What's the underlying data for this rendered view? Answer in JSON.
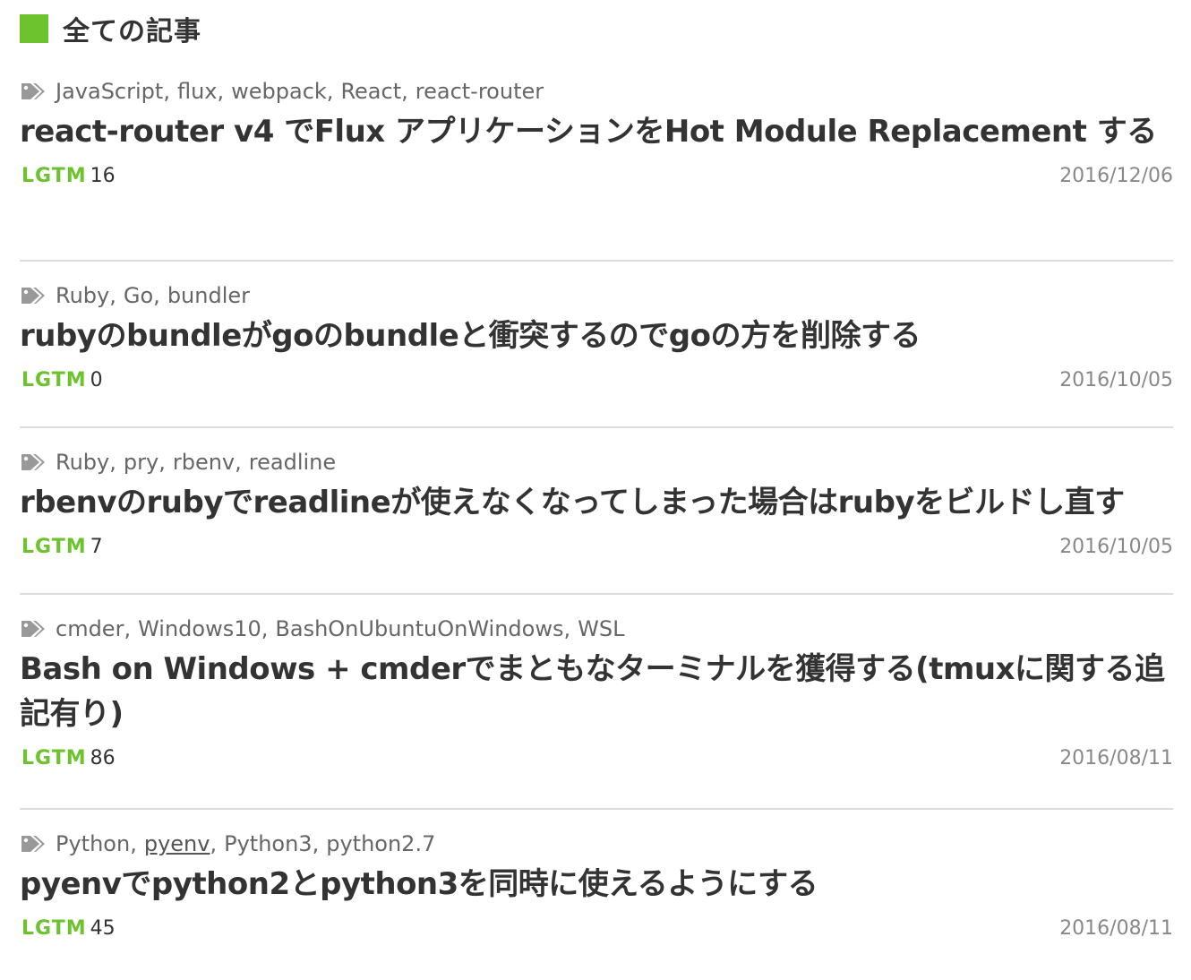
{
  "section": {
    "title": "全ての記事",
    "accent_color": "#6cc32d"
  },
  "lgtm_label": "LGTM",
  "articles": [
    {
      "tags": [
        "JavaScript",
        "flux",
        "webpack",
        "React",
        "react-router"
      ],
      "title": "react-router v4 でFlux アプリケーションをHot Module Replacement する",
      "lgtm": "16",
      "date": "2016/12/06"
    },
    {
      "tags": [
        "Ruby",
        "Go",
        "bundler"
      ],
      "title": "rubyのbundleがgoのbundleと衝突するのでgoの方を削除する",
      "lgtm": "0",
      "date": "2016/10/05"
    },
    {
      "tags": [
        "Ruby",
        "pry",
        "rbenv",
        "readline"
      ],
      "title": "rbenvのrubyでreadlineが使えなくなってしまった場合はrubyをビルドし直す",
      "lgtm": "7",
      "date": "2016/10/05"
    },
    {
      "tags": [
        "cmder",
        "Windows10",
        "BashOnUbuntuOnWindows",
        "WSL"
      ],
      "title": "Bash on Windows + cmderでまともなターミナルを獲得する(tmuxに関する追記有り)",
      "lgtm": "86",
      "date": "2016/08/11"
    },
    {
      "tags": [
        "Python",
        "pyenv",
        "Python3",
        "python2.7"
      ],
      "title": "pyenvでpython2とpython3を同時に使えるようにする",
      "lgtm": "45",
      "date": "2016/08/11"
    }
  ],
  "tag_separator": ",",
  "icons": {
    "tag": "tags-icon"
  }
}
